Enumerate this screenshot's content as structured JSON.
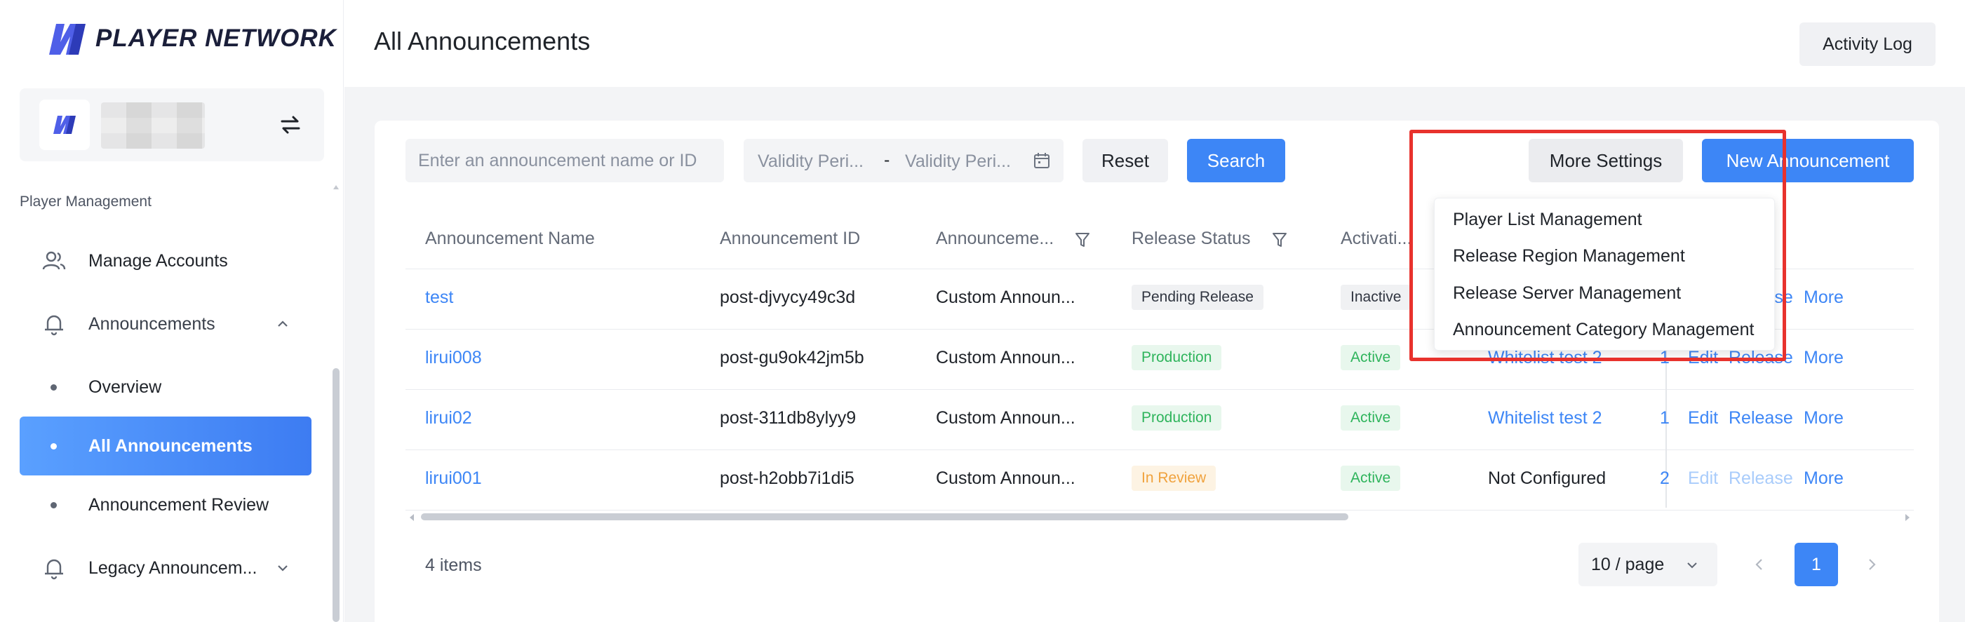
{
  "brand": {
    "name": "PLAYER NETWORK"
  },
  "sidebar": {
    "section_label": "Player Management",
    "items": [
      {
        "label": "Manage Accounts",
        "icon": "users-icon"
      },
      {
        "label": "Announcements",
        "icon": "bell-icon",
        "expanded": true
      },
      {
        "label": "Overview"
      },
      {
        "label": "All Announcements",
        "active": true
      },
      {
        "label": "Announcement Review"
      },
      {
        "label": "Legacy Announcem...",
        "icon": "bell-icon",
        "expanded": false
      }
    ]
  },
  "header": {
    "title": "All Announcements",
    "activity_log": "Activity Log"
  },
  "toolbar": {
    "search_placeholder": "Enter an announcement name or ID",
    "validity_start_placeholder": "Validity Peri...",
    "date_separator": "-",
    "validity_end_placeholder": "Validity Peri...",
    "reset_label": "Reset",
    "search_label": "Search",
    "more_settings_label": "More Settings",
    "new_announcement_label": "New Announcement"
  },
  "dropdown": {
    "items": [
      "Player List Management",
      "Release Region Management",
      "Release Server Management",
      "Announcement Category Management"
    ]
  },
  "table": {
    "columns": [
      "Announcement Name",
      "Announcement ID",
      "Announceme...",
      "Release Status",
      "Activati..."
    ],
    "rows": [
      {
        "name": "test",
        "id": "post-djvycy49c3d",
        "type": "Custom Announ...",
        "status": "Pending Release",
        "activation": "Inactive",
        "whitelist": "",
        "extra": "",
        "actions": [
          "Release",
          "More"
        ]
      },
      {
        "name": "lirui008",
        "id": "post-gu9ok42jm5b",
        "type": "Custom Announ...",
        "status": "Production",
        "activation": "Active",
        "whitelist": "Whitelist test 2",
        "extra": "1",
        "actions": [
          "Edit",
          "Release",
          "More"
        ]
      },
      {
        "name": "lirui02",
        "id": "post-311db8ylyy9",
        "type": "Custom Announ...",
        "status": "Production",
        "activation": "Active",
        "whitelist": "Whitelist test 2",
        "extra": "1",
        "actions": [
          "Edit",
          "Release",
          "More"
        ]
      },
      {
        "name": "lirui001",
        "id": "post-h2obb7i1di5",
        "type": "Custom Announ...",
        "status": "In Review",
        "activation": "Active",
        "whitelist": "Not Configured",
        "extra": "2",
        "actions": [
          "Edit",
          "Release",
          "More"
        ]
      }
    ]
  },
  "pagination": {
    "items_count": "4 items",
    "page_size": "10 / page",
    "current_page": "1"
  },
  "colors": {
    "accent": "#3d86f6",
    "highlight": "#e8322d",
    "success": "#2fb45c",
    "warning": "#f0a23d"
  }
}
